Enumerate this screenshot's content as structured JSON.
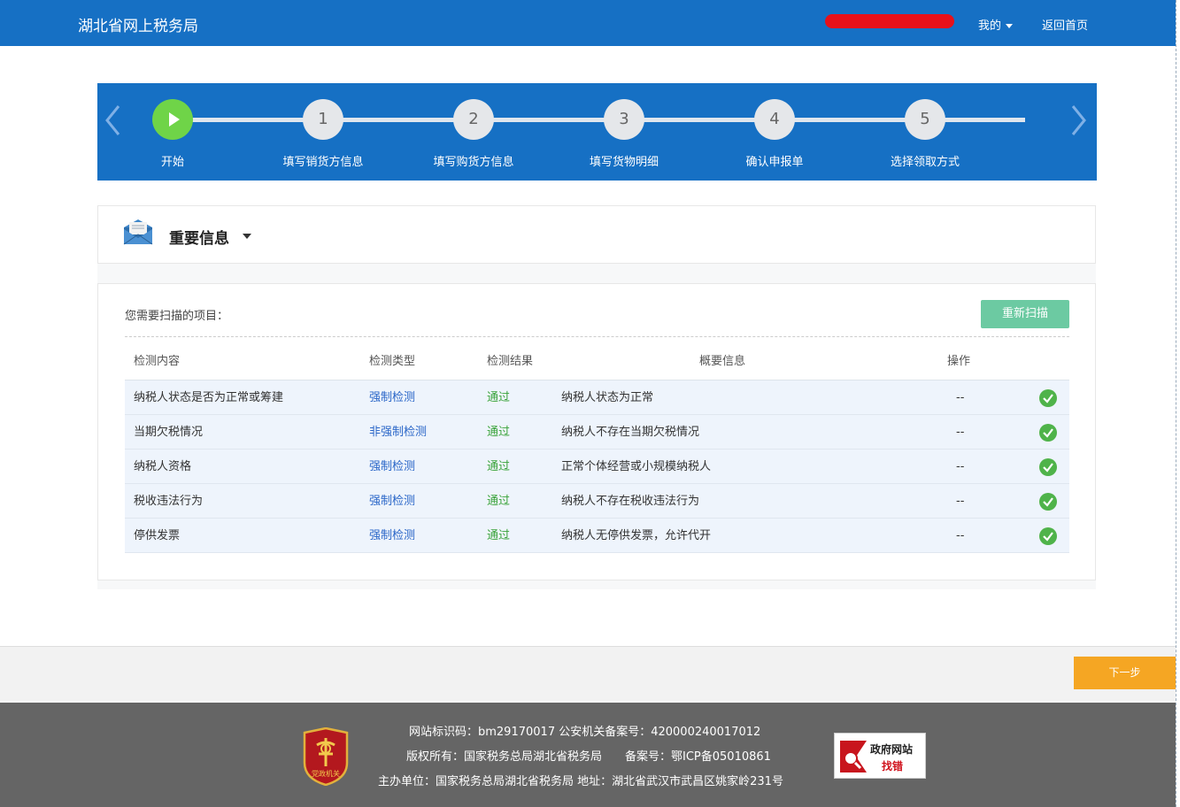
{
  "header": {
    "site_title": "湖北省网上税务局",
    "mine_label": "我的",
    "home_label": "返回首页"
  },
  "stepper": {
    "steps": [
      {
        "number": "",
        "label": "开始"
      },
      {
        "number": "1",
        "label": "填写销货方信息"
      },
      {
        "number": "2",
        "label": "填写购货方信息"
      },
      {
        "number": "3",
        "label": "填写货物明细"
      },
      {
        "number": "4",
        "label": "确认申报单"
      },
      {
        "number": "5",
        "label": "选择领取方式"
      }
    ]
  },
  "info_panel": {
    "title": "重要信息"
  },
  "scan": {
    "prompt": "您需要扫描的项目：",
    "rescan_label": "重新扫描",
    "columns": {
      "content": "检测内容",
      "type": "检测类型",
      "result": "检测结果",
      "summary": "概要信息",
      "operation": "操作"
    },
    "rows": [
      {
        "content": "纳税人状态是否为正常或筹建",
        "type": "强制检测",
        "result": "通过",
        "summary": "纳税人状态为正常",
        "operation": "--"
      },
      {
        "content": "当期欠税情况",
        "type": "非强制检测",
        "result": "通过",
        "summary": "纳税人不存在当期欠税情况",
        "operation": "--"
      },
      {
        "content": "纳税人资格",
        "type": "强制检测",
        "result": "通过",
        "summary": "正常个体经营或小规模纳税人",
        "operation": "--"
      },
      {
        "content": "税收违法行为",
        "type": "强制检测",
        "result": "通过",
        "summary": "纳税人不存在税收违法行为",
        "operation": "--"
      },
      {
        "content": "停供发票",
        "type": "强制检测",
        "result": "通过",
        "summary": "纳税人无停供发票，允许代开",
        "operation": "--"
      }
    ]
  },
  "actions": {
    "next_label": "下一步"
  },
  "footer": {
    "line1": "网站标识码：bm29170017 公安机关备案号：420000240017012",
    "line2": "版权所有：国家税务总局湖北省税务局　　备案号：鄂ICP备05010861",
    "line3": "主办单位：国家税务总局湖北省税务局 地址：湖北省武汉市武昌区姚家岭231号",
    "party_badge_text": "党政机关",
    "gov_badge_line1": "政府网站",
    "gov_badge_line2": "找错"
  },
  "colors": {
    "brand_blue": "#1670c4",
    "active_step": "#6fd448",
    "rescan_green": "#6ccaa2",
    "pass_green": "#3aa33a",
    "link_blue": "#2a66c8",
    "next_orange": "#f5a623",
    "footer_gray": "#656565"
  },
  "icons": {
    "play": "play-icon",
    "mail": "mail-icon",
    "check": "check-circle-icon",
    "arrow_left": "chevron-left-icon",
    "arrow_right": "chevron-right-icon"
  }
}
